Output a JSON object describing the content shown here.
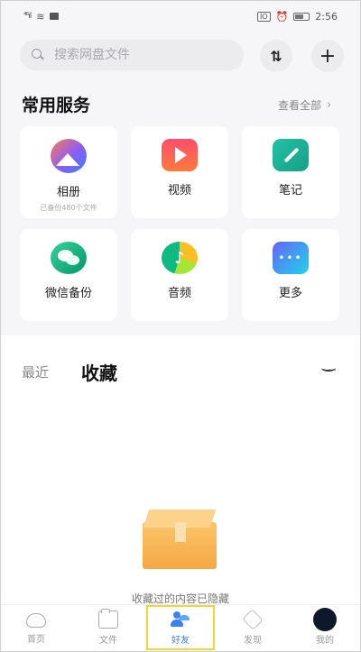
{
  "statusbar": {
    "signal": "⁴⁶ıl",
    "time": "2:56",
    "battery_badge": "IO",
    "alarm": "⏰"
  },
  "search": {
    "placeholder": "搜索网盘文件"
  },
  "toolbar": {
    "sort_glyph": "⇅",
    "add_glyph": "+"
  },
  "services": {
    "title": "常用服务",
    "view_all": "查看全部",
    "items": [
      {
        "label": "相册",
        "sub": "已备份480个文件",
        "icon": "photo-album-icon"
      },
      {
        "label": "视频",
        "icon": "video-play-icon"
      },
      {
        "label": "笔记",
        "icon": "note-pen-icon"
      },
      {
        "label": "微信备份",
        "icon": "wechat-backup-icon"
      },
      {
        "label": "音频",
        "icon": "audio-music-icon"
      },
      {
        "label": "更多",
        "icon": "more-dots-icon"
      }
    ]
  },
  "tabs": {
    "recent": "最近",
    "favorites": "收藏"
  },
  "empty": {
    "message": "收藏过的内容已隐藏"
  },
  "bottom_nav": [
    {
      "label": "首页",
      "icon": "home-cloud-icon"
    },
    {
      "label": "文件",
      "icon": "folder-icon"
    },
    {
      "label": "好友",
      "icon": "friends-icon",
      "active": true
    },
    {
      "label": "发现",
      "icon": "discover-icon"
    },
    {
      "label": "我的",
      "icon": "avatar-icon"
    }
  ],
  "colors": {
    "accent": "#3b82f6",
    "highlight_border": "#f2d33a",
    "background": "#f6f6f8"
  }
}
